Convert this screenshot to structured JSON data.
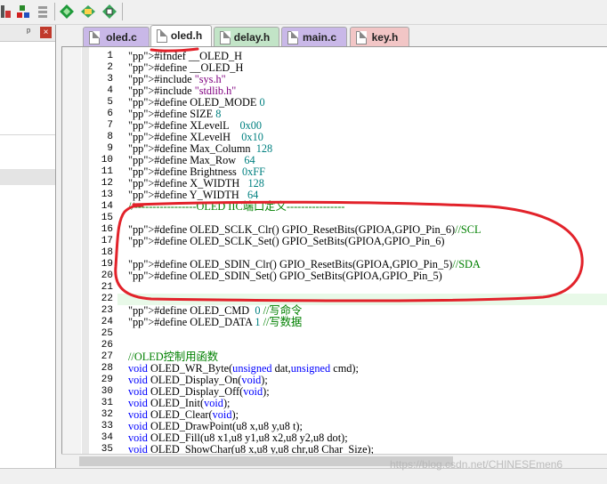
{
  "toolbar": {
    "icons": [
      "build-target-icon",
      "batch-build-icon",
      "insert-icon",
      "diamond-icon",
      "packs-icon",
      "green-box-icon"
    ]
  },
  "left_panel": {
    "pin": "ᵖ",
    "close": "×"
  },
  "tabs": [
    {
      "label": "oled.c",
      "active": false,
      "color": "#c9b8e8"
    },
    {
      "label": "oled.h",
      "active": true,
      "color": "#ffffff"
    },
    {
      "label": "delay.h",
      "active": false,
      "color": "#c2e4c7"
    },
    {
      "label": "main.c",
      "active": false,
      "color": "#c9b8e8"
    },
    {
      "label": "key.h",
      "active": false,
      "color": "#f2c6c6"
    }
  ],
  "code_lines": [
    {
      "n": "1",
      "t": "#ifndef __OLED_H"
    },
    {
      "n": "2",
      "t": "#define __OLED_H"
    },
    {
      "n": "3",
      "t": "#include \"sys.h\""
    },
    {
      "n": "4",
      "t": "#include \"stdlib.h\""
    },
    {
      "n": "5",
      "t": "#define OLED_MODE 0"
    },
    {
      "n": "6",
      "t": "#define SIZE 8"
    },
    {
      "n": "7",
      "t": "#define XLevelL    0x00"
    },
    {
      "n": "8",
      "t": "#define XLevelH    0x10"
    },
    {
      "n": "9",
      "t": "#define Max_Column  128"
    },
    {
      "n": "10",
      "t": "#define Max_Row   64"
    },
    {
      "n": "11",
      "t": "#define Brightness  0xFF"
    },
    {
      "n": "12",
      "t": "#define X_WIDTH   128"
    },
    {
      "n": "13",
      "t": "#define Y_WIDTH   64"
    },
    {
      "n": "14",
      "t": "//-----------------OLED IIC端口定义----------------"
    },
    {
      "n": "15",
      "t": ""
    },
    {
      "n": "16",
      "t": "#define OLED_SCLK_Clr() GPIO_ResetBits(GPIOA,GPIO_Pin_6)//SCL"
    },
    {
      "n": "17",
      "t": "#define OLED_SCLK_Set() GPIO_SetBits(GPIOA,GPIO_Pin_6)"
    },
    {
      "n": "18",
      "t": ""
    },
    {
      "n": "19",
      "t": "#define OLED_SDIN_Clr() GPIO_ResetBits(GPIOA,GPIO_Pin_5)//SDA"
    },
    {
      "n": "20",
      "t": "#define OLED_SDIN_Set() GPIO_SetBits(GPIOA,GPIO_Pin_5)"
    },
    {
      "n": "21",
      "t": ""
    },
    {
      "n": "22",
      "t": ""
    },
    {
      "n": "23",
      "t": "#define OLED_CMD  0 //写命令"
    },
    {
      "n": "24",
      "t": "#define OLED_DATA 1 //写数据"
    },
    {
      "n": "25",
      "t": ""
    },
    {
      "n": "26",
      "t": ""
    },
    {
      "n": "27",
      "t": "//OLED控制用函数"
    },
    {
      "n": "28",
      "t": "void OLED_WR_Byte(unsigned dat,unsigned cmd);"
    },
    {
      "n": "29",
      "t": "void OLED_Display_On(void);"
    },
    {
      "n": "30",
      "t": "void OLED_Display_Off(void);"
    },
    {
      "n": "31",
      "t": "void OLED_Init(void);"
    },
    {
      "n": "32",
      "t": "void OLED_Clear(void);"
    },
    {
      "n": "33",
      "t": "void OLED_DrawPoint(u8 x,u8 y,u8 t);"
    },
    {
      "n": "34",
      "t": "void OLED_Fill(u8 x1,u8 y1,u8 x2,u8 y2,u8 dot);"
    },
    {
      "n": "35",
      "t": "void OLED_ShowChar(u8 x,u8 y,u8 chr,u8 Char_Size);"
    }
  ],
  "highlighted_line": "22",
  "watermark": "https://blog.csdn.net/CHINESEmen6"
}
